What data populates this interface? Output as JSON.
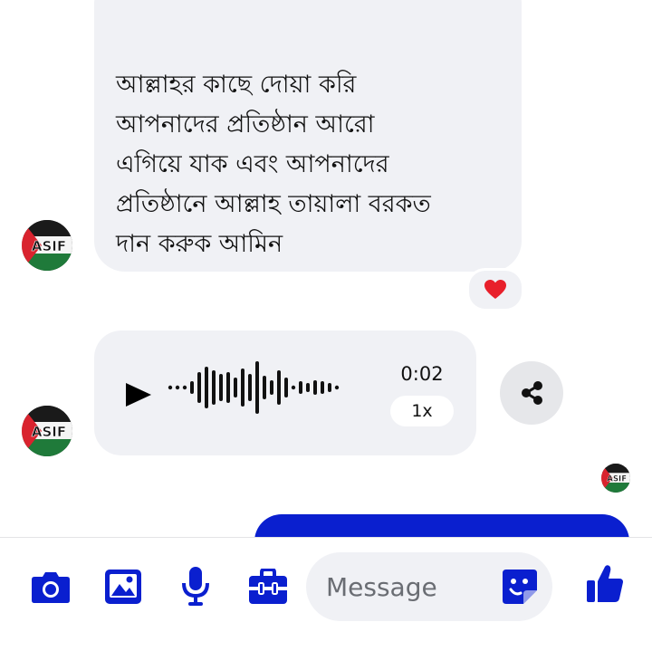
{
  "incoming_text_message": {
    "lines": [
      "আল্লাহর কাছে দোয়া করি",
      "আপনাদের প্রতিষ্ঠান আরো",
      "এগিয়ে যাক এবং আপনাদের",
      "প্রতিষ্ঠানে আল্লাহ তায়ালা বরকত",
      "দান করুক  আমিন"
    ],
    "reaction": "❤️"
  },
  "voice_message": {
    "duration": "0:02",
    "playback_speed": "1x"
  },
  "avatar": {
    "label": "ASIF"
  },
  "composer": {
    "placeholder": "Message",
    "value": ""
  },
  "colors": {
    "accent": "#0a1fcf",
    "bubble_bg": "#f0f1f5",
    "reaction_heart": "#e8202b"
  },
  "icons": {
    "camera": "camera-icon",
    "gallery": "image-icon",
    "microphone": "microphone-icon",
    "toolbox": "briefcase-icon",
    "sticker": "sticker-icon",
    "like": "thumbs-up-icon",
    "share": "share-icon",
    "play": "play-icon"
  }
}
